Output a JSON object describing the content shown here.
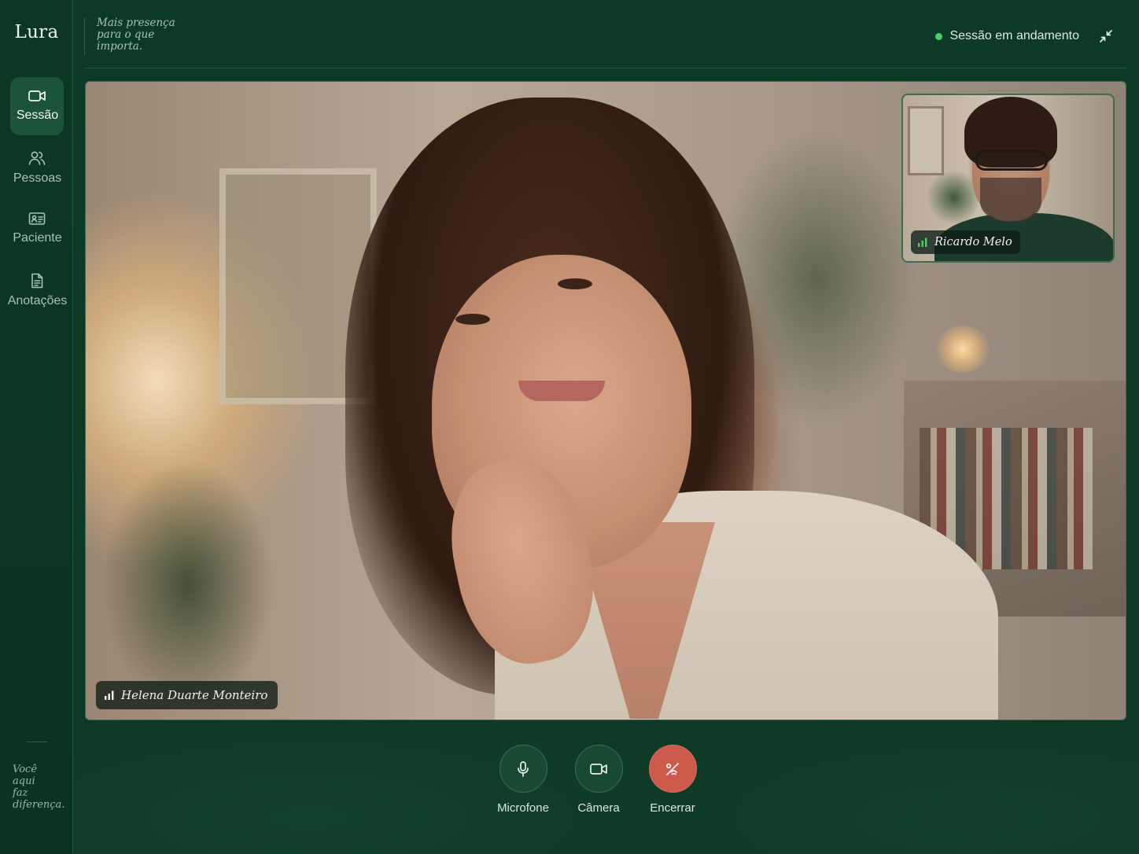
{
  "app": {
    "brand": "Lura",
    "tagline_lines": [
      "Mais presença",
      "para o que",
      "importa."
    ]
  },
  "sidebar": {
    "items": [
      {
        "label": "Sessão",
        "icon": "video-icon",
        "active": true
      },
      {
        "label": "Pessoas",
        "icon": "people-icon",
        "active": false
      },
      {
        "label": "Paciente",
        "icon": "id-card-icon",
        "active": false
      },
      {
        "label": "Anotações",
        "icon": "document-icon",
        "active": false
      }
    ],
    "quote_lines": [
      "Você",
      "aqui",
      "faz",
      "diferença."
    ]
  },
  "header": {
    "status_text": "Sessão em andamento",
    "status_color": "#43d36b",
    "collapse_icon": "minimize-arrows-icon"
  },
  "video": {
    "main_participant": "Helena Duarte Monteiro",
    "pip_participant": "Ricardo Melo",
    "signal_icon": "signal-bars-icon"
  },
  "controls": [
    {
      "label": "Microfone",
      "icon": "microphone-icon"
    },
    {
      "label": "Câmera",
      "icon": "camera-icon"
    },
    {
      "label": "Encerrar",
      "icon": "end-call-icon",
      "color": "#cc5b4e"
    }
  ],
  "colors": {
    "background": "#0d3a26",
    "sidebar_active": "#1c5438",
    "accent_green": "#43d36b",
    "end_call": "#cc5b4e"
  }
}
